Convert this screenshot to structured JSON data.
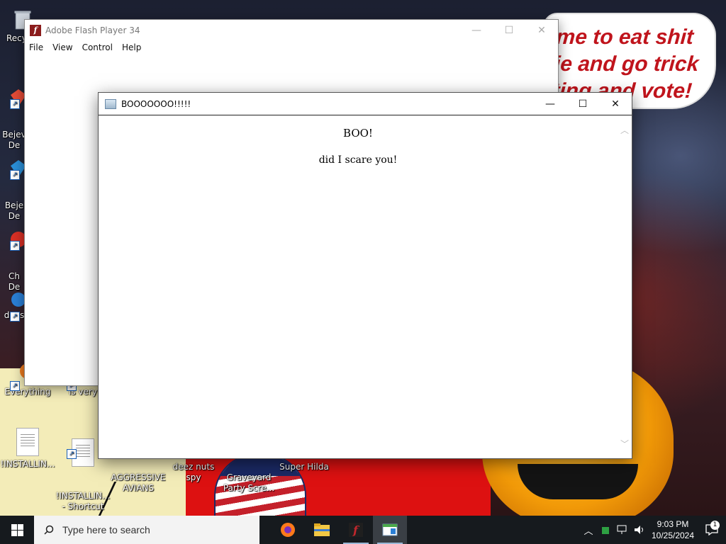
{
  "desktop": {
    "speech_bubble": "me to eat shit\nie and go trick\nting and vote!",
    "icons": [
      {
        "label": "Recy",
        "icon": "recycle-bin-icon"
      },
      {
        "label": "Bejev\nDe",
        "icon": "gem-icon"
      },
      {
        "label": "Beje\nDe",
        "icon": "gem-icon"
      },
      {
        "label": "Ch\nDe",
        "icon": "chrome-icon"
      },
      {
        "label": "does",
        "icon": "app-icon"
      },
      {
        "label": "Everything",
        "icon": "search-app-icon"
      },
      {
        "label": "is very",
        "icon": "app-icon"
      },
      {
        "label": "!INSTALLIN...",
        "icon": "document-icon"
      },
      {
        "label": "!INSTALLIN...\n- Shortcut",
        "icon": "document-icon"
      },
      {
        "label": "AGGRESSIVE\nAVIANS",
        "icon": "game-icon"
      },
      {
        "label": "deez nuts spy",
        "icon": "app-icon"
      },
      {
        "label": "Graveyard\nParty Scre...",
        "icon": "game-icon"
      },
      {
        "label": "Super Hilda",
        "icon": "game-icon"
      }
    ]
  },
  "flash_window": {
    "title": "Adobe Flash Player 34",
    "logo_glyph": "f",
    "menu": [
      "File",
      "View",
      "Control",
      "Help"
    ],
    "controls": {
      "minimize": "—",
      "maximize": "☐",
      "close": "✕"
    }
  },
  "boo_window": {
    "title": "BOOOOOOO!!!!!",
    "heading": "BOO!",
    "message": "did I scare you!",
    "controls": {
      "minimize": "—",
      "maximize": "☐",
      "close": "✕"
    },
    "scroll_up": "︿",
    "scroll_down": "﹀"
  },
  "taskbar": {
    "search_placeholder": "Type here to search",
    "apps": [
      {
        "name": "firefox-icon",
        "glyph": "◉",
        "color": "#ff7a1a"
      },
      {
        "name": "file-explorer-icon",
        "glyph": "▬",
        "color": "#f2c744"
      },
      {
        "name": "flash-player-icon",
        "glyph": "f",
        "color": "#c1272d"
      },
      {
        "name": "dialog-app-icon",
        "glyph": "▣",
        "color": "#cfe3f5"
      }
    ],
    "tray": {
      "chevron": "︿",
      "clock_time": "9:03 PM",
      "clock_date": "10/25/2024",
      "notification_count": "1"
    }
  },
  "colors": {
    "taskbar": "#161a1e",
    "speech_text": "#c0141c",
    "flash_logo": "#8b1c1c"
  }
}
